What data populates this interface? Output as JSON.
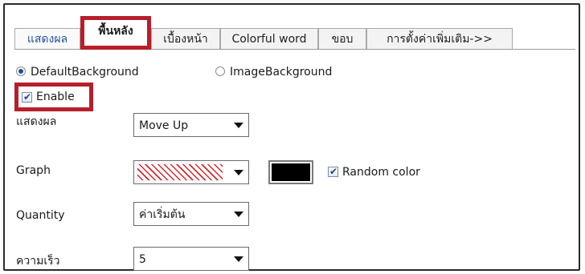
{
  "tabs": [
    {
      "label": "แสดงผล"
    },
    {
      "label": "พื้นหลัง"
    },
    {
      "label": "เบื้องหน้า"
    },
    {
      "label": "Colorful word"
    },
    {
      "label": "ขอบ"
    },
    {
      "label": "การตั้งค่าเพิ่มเติม->>"
    }
  ],
  "active_tab_index": 1,
  "background": {
    "default_label": "DefaultBackground",
    "image_label": "ImageBackground",
    "selected": "DefaultBackground"
  },
  "enable": {
    "label": "Enable",
    "checked": true
  },
  "settings": {
    "display_label": "แสดงผล",
    "display_value": "Move Up",
    "graph_label": "Graph",
    "graph_color": "#000000",
    "random_color_label": "Random color",
    "random_color_checked": true,
    "quantity_label": "Quantity",
    "quantity_value": "ค่าเริ่มต้น",
    "speed_label": "ความเร็ว",
    "speed_value": "5"
  },
  "colors": {
    "highlight": "#b61f2b",
    "tab_accent": "#1f4e9a",
    "hatch": "#d8262e"
  }
}
